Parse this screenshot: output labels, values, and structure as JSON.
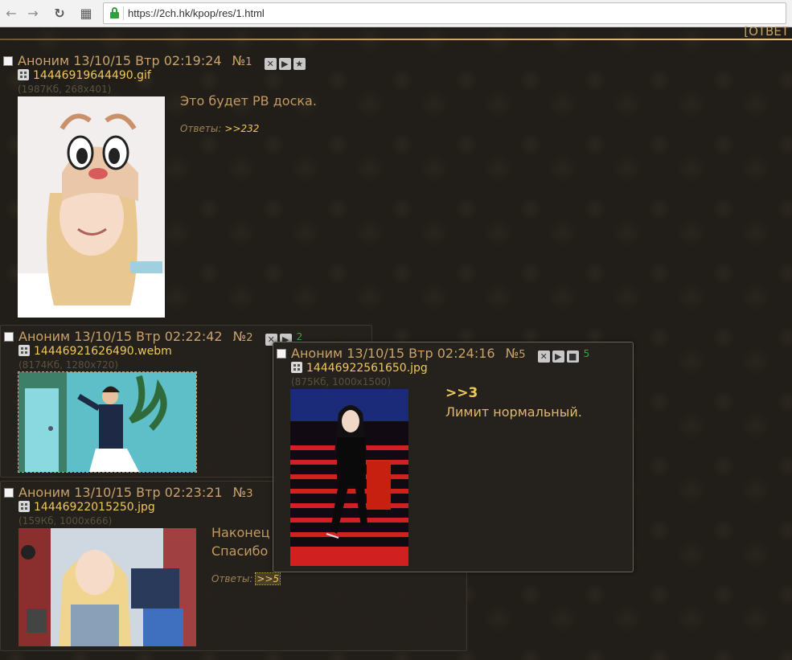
{
  "browser": {
    "back_icon": "←",
    "forward_icon": "→",
    "reload_icon": "↻",
    "apps_icon": "▦",
    "url": "https://2ch.hk/kpop/res/1.html"
  },
  "board": {
    "top_partial_text": "[ОТВЕТ"
  },
  "posts": [
    {
      "author": "Аноним",
      "date": "13/10/15 Втр 02:19:24",
      "number_prefix": "№",
      "number": "1",
      "file_name": "14446919644490.gif",
      "file_meta": "(1987Кб, 268x401)",
      "text_lines": [
        "Это будет РВ доска."
      ],
      "replies_label": "Ответы:",
      "reply_links": [
        ">>232"
      ]
    },
    {
      "author": "Аноним",
      "date": "13/10/15 Втр 02:22:42",
      "number_prefix": "№",
      "number": "2",
      "reply_count": "2",
      "file_name": "14446921626490.webm",
      "file_meta": "(8174Кб, 1280x720)"
    },
    {
      "author": "Аноним",
      "date": "13/10/15 Втр 02:23:21",
      "number_prefix": "№",
      "number": "3",
      "file_name": "14446922015250.jpg",
      "file_meta": "(159Кб, 1000x666)",
      "text_lines": [
        "Наконец",
        "Спасибо"
      ],
      "replies_label": "Ответы:",
      "reply_links": [
        ">>5"
      ]
    },
    {
      "author": "Аноним",
      "date": "13/10/15 Втр 02:24:16",
      "number_prefix": "№",
      "number": "5",
      "reply_count": "5",
      "file_name": "14446922561650.jpg",
      "file_meta": "(875Кб, 1000x1500)",
      "quote": ">>3",
      "text_lines": [
        "Лимит нормальный."
      ]
    }
  ]
}
